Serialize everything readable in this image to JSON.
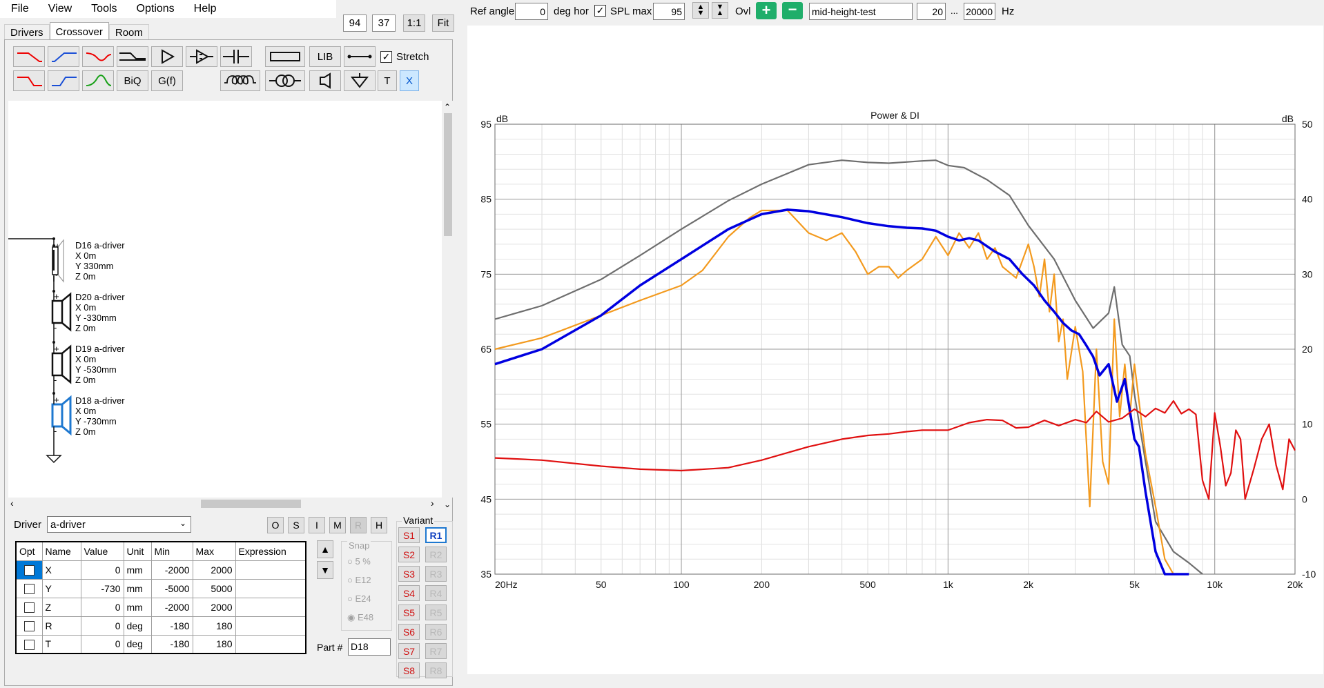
{
  "menu": {
    "items": [
      "File",
      "View",
      "Tools",
      "Options",
      "Help"
    ]
  },
  "top_boxes": {
    "a": "94",
    "b": "37",
    "one_to_one": "1:1",
    "fit": "Fit"
  },
  "tabs": [
    "Drivers",
    "Crossover",
    "Room"
  ],
  "toolbar": {
    "lib": "LIB",
    "biq": "BiQ",
    "gf": "G(f)",
    "t": "T",
    "x": "X",
    "stretch_label": "Stretch",
    "stretch_checked": true
  },
  "drivers": [
    {
      "name": "D16 a-driver",
      "x": "X 0m",
      "y": "Y 330mm",
      "z": "Z 0m"
    },
    {
      "name": "D20 a-driver",
      "x": "X 0m",
      "y": "Y -330mm",
      "z": "Z 0m"
    },
    {
      "name": "D19 a-driver",
      "x": "X 0m",
      "y": "Y -530mm",
      "z": "Z 0m"
    },
    {
      "name": "D18 a-driver",
      "x": "X 0m",
      "y": "Y -730mm",
      "z": "Z 0m"
    }
  ],
  "driver_row": {
    "label": "Driver",
    "selected": "a-driver",
    "btns": [
      "O",
      "S",
      "I",
      "M",
      "R",
      "H"
    ]
  },
  "table": {
    "headers": [
      "Opt",
      "Name",
      "Value",
      "Unit",
      "Min",
      "Max",
      "Expression"
    ],
    "rows": [
      {
        "name": "X",
        "value": "0",
        "unit": "mm",
        "min": "-2000",
        "max": "2000"
      },
      {
        "name": "Y",
        "value": "-730",
        "unit": "mm",
        "min": "-5000",
        "max": "5000"
      },
      {
        "name": "Z",
        "value": "0",
        "unit": "mm",
        "min": "-2000",
        "max": "2000"
      },
      {
        "name": "R",
        "value": "0",
        "unit": "deg",
        "min": "-180",
        "max": "180"
      },
      {
        "name": "T",
        "value": "0",
        "unit": "deg",
        "min": "-180",
        "max": "180"
      }
    ]
  },
  "snap": {
    "label": "Snap",
    "options": [
      "5 %",
      "E12",
      "E24",
      "E48"
    ],
    "selected": "E48"
  },
  "part": {
    "label": "Part #",
    "value": "D18"
  },
  "variant": {
    "label": "Variant",
    "s": [
      "S1",
      "S2",
      "S3",
      "S4",
      "S5",
      "S6",
      "S7",
      "S8"
    ],
    "r": [
      "R1",
      "R2",
      "R3",
      "R4",
      "R5",
      "R6",
      "R7",
      "R8"
    ],
    "active_r": "R1"
  },
  "ref_bar": {
    "ref_angle_label": "Ref angle",
    "ref_angle": "0",
    "deg_hor": "deg hor",
    "spl_max_label": "SPL max",
    "spl_max": "95",
    "ovl": "Ovl",
    "name": "mid-height-test",
    "f_min": "20",
    "dots": "...",
    "f_max": "20000",
    "hz": "Hz"
  },
  "colors": {
    "grey": "#6e6e6e",
    "orange": "#f39a1e",
    "blue": "#0000e0",
    "red": "#e01010"
  },
  "chart_data": {
    "type": "line",
    "title": "Power & DI",
    "xscale": "log",
    "xlim": [
      20,
      20000
    ],
    "ylim": [
      35,
      95
    ],
    "y2lim": [
      -10,
      50
    ],
    "ylabel": "dB",
    "y2label": "dB",
    "xticks": [
      20,
      50,
      100,
      200,
      500,
      1000,
      2000,
      5000,
      10000,
      20000
    ],
    "xtick_labels": [
      "20Hz",
      "50",
      "100",
      "200",
      "500",
      "1k",
      "2k",
      "5k",
      "10k",
      "20k"
    ],
    "yticks": [
      95,
      85,
      75,
      65,
      55,
      45,
      35
    ],
    "y2ticks": [
      50,
      40,
      30,
      20,
      10,
      0,
      -10
    ],
    "grid": true,
    "series": [
      {
        "color": "#6e6e6e",
        "axis": "left",
        "x": [
          20,
          30,
          50,
          70,
          100,
          150,
          200,
          300,
          400,
          500,
          600,
          800,
          900,
          1000,
          1150,
          1400,
          1700,
          2000,
          2500,
          3000,
          3500,
          4000,
          4200,
          4500,
          4800,
          5000,
          5500,
          6000,
          7000,
          8000,
          9000
        ],
        "y": [
          69,
          70.8,
          74.3,
          77.5,
          81,
          84.8,
          87,
          89.6,
          90.2,
          89.9,
          89.8,
          90.1,
          90.2,
          89.5,
          89.2,
          87.6,
          85.5,
          81.5,
          77,
          71.5,
          67.8,
          69.8,
          73.3,
          65.6,
          64.1,
          59,
          50,
          42,
          38,
          36.5,
          35
        ]
      },
      {
        "color": "#f39a1e",
        "axis": "left",
        "x": [
          20,
          30,
          50,
          70,
          100,
          120,
          150,
          180,
          200,
          250,
          300,
          350,
          400,
          450,
          500,
          550,
          600,
          650,
          700,
          800,
          900,
          1000,
          1100,
          1200,
          1300,
          1400,
          1500,
          1600,
          1800,
          2000,
          2100,
          2200,
          2300,
          2400,
          2500,
          2600,
          2700,
          2800,
          3000,
          3200,
          3400,
          3600,
          3800,
          4000,
          4200,
          4400,
          4600,
          4800,
          5000,
          5500,
          6000,
          6500,
          7000
        ],
        "y": [
          65,
          66.5,
          69.5,
          71.5,
          73.5,
          75.5,
          80,
          82.5,
          83.5,
          83.5,
          80.5,
          79.5,
          80.5,
          78,
          75,
          76,
          76,
          74.5,
          75.5,
          77,
          80,
          77.5,
          80.5,
          78.5,
          80.5,
          77,
          78.5,
          76,
          74.5,
          79,
          76,
          72,
          77,
          70,
          75,
          66,
          69,
          61,
          68,
          62,
          44,
          65,
          50,
          47,
          69,
          56,
          63,
          56,
          63,
          51,
          44,
          37,
          35
        ]
      },
      {
        "color": "#0000e0",
        "axis": "left",
        "x": [
          20,
          30,
          50,
          70,
          100,
          150,
          200,
          250,
          300,
          400,
          500,
          600,
          700,
          800,
          900,
          1000,
          1100,
          1200,
          1300,
          1500,
          1700,
          1900,
          2100,
          2300,
          2500,
          2700,
          2900,
          3100,
          3300,
          3500,
          3700,
          4000,
          4300,
          4600,
          5000,
          5200,
          5500,
          6000,
          6500,
          7000,
          8000
        ],
        "y": [
          63,
          65,
          69.5,
          73.5,
          77,
          81,
          83,
          83.6,
          83.4,
          82.6,
          81.8,
          81.4,
          81.2,
          81.1,
          80.8,
          80,
          79.5,
          79.8,
          79.5,
          78,
          77,
          75,
          73.5,
          71.5,
          70,
          68.5,
          67.5,
          67,
          65.5,
          64,
          61.5,
          63,
          58,
          61,
          53,
          52,
          46,
          38,
          35,
          34,
          33
        ]
      },
      {
        "color": "#e01010",
        "axis": "right",
        "x": [
          20,
          30,
          50,
          70,
          100,
          150,
          200,
          300,
          400,
          500,
          600,
          700,
          800,
          1000,
          1200,
          1400,
          1600,
          1800,
          2000,
          2300,
          2600,
          3000,
          3300,
          3600,
          4000,
          4500,
          5000,
          5500,
          6000,
          6500,
          7000,
          7500,
          8000,
          8500,
          9000,
          9500,
          10000,
          10500,
          11000,
          11500,
          12000,
          12500,
          13000,
          14000,
          15000,
          16000,
          17000,
          18000,
          19000,
          20000
        ],
        "y": [
          5.5,
          5.2,
          4.4,
          4,
          3.8,
          4.2,
          5.2,
          7,
          8,
          8.5,
          8.7,
          9,
          9.2,
          9.2,
          10.2,
          10.6,
          10.5,
          9.5,
          9.6,
          10.5,
          9.8,
          10.6,
          10.2,
          11.7,
          10.3,
          10.8,
          12,
          11,
          12.1,
          11.5,
          13.1,
          11.4,
          12,
          11.3,
          2.5,
          0,
          11.5,
          7,
          1.8,
          3.5,
          9.2,
          8,
          0,
          4,
          8,
          10,
          4.5,
          1.3,
          8,
          6.5
        ]
      }
    ]
  }
}
